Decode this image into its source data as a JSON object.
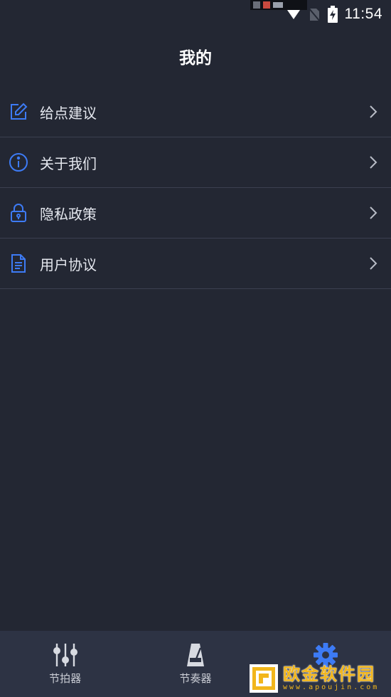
{
  "status_bar": {
    "time": "11:54",
    "icons": [
      "notification-thumbnails",
      "wifi-icon",
      "no-sim-icon",
      "battery-charging-icon"
    ]
  },
  "header": {
    "title": "我的"
  },
  "menu": {
    "items": [
      {
        "label": "给点建议",
        "icon": "edit-icon"
      },
      {
        "label": "关于我们",
        "icon": "info-icon"
      },
      {
        "label": "隐私政策",
        "icon": "lock-icon"
      },
      {
        "label": "用户协议",
        "icon": "document-icon"
      }
    ]
  },
  "bottom_nav": {
    "tabs": [
      {
        "label": "节拍器",
        "icon": "sliders-icon"
      },
      {
        "label": "节奏器",
        "icon": "metronome-icon"
      },
      {
        "label": "",
        "icon": "gear-icon",
        "active": true
      }
    ]
  },
  "watermark": {
    "text": "欧金软件园",
    "sub": "www.apoujin.com"
  },
  "colors": {
    "background": "#232733",
    "nav_background": "#2d3344",
    "accent": "#3d7bf5",
    "divider": "#3b4050"
  }
}
